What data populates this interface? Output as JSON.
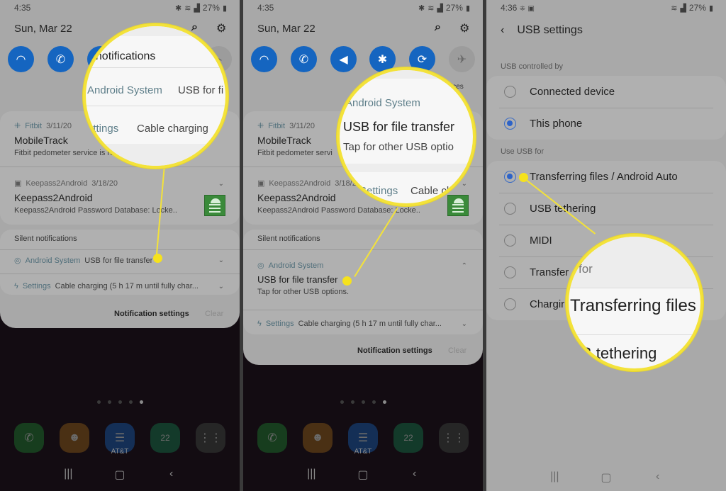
{
  "panel1": {
    "status": {
      "time": "4:35",
      "battery": "27%",
      "icons": [
        "bluetooth-icon",
        "wifi-calling-icon",
        "signal-icon",
        "battery-icon"
      ]
    },
    "date": "Sun, Mar 22",
    "quick_settings": [
      "wifi",
      "wifi-calling",
      "sound",
      "flashlight"
    ],
    "notifications": [
      {
        "app": "Fitbit",
        "time": "3/11/20",
        "title": "MobileTrack",
        "body": "Fitbit pedometer service is running"
      },
      {
        "app": "Keepass2Android",
        "time": "3/18/20",
        "title": "Keepass2Android",
        "body": "Keepass2Android Password Database: Locke.."
      }
    ],
    "silent_label": "Silent notifications",
    "silent": [
      {
        "app": "Android System",
        "text": "USB for file transfer"
      },
      {
        "app": "Settings",
        "text": "Cable charging (5 h 17 m until fully char..."
      }
    ],
    "footer": {
      "settings": "Notification settings",
      "clear": "Clear"
    },
    "carrier": "AT&T",
    "calendar_day": "22",
    "magnifier": {
      "line1": "t notifications",
      "line2_app": "Android System",
      "line2_text": "USB for fi",
      "line3_app": "ettings",
      "line3_text": "Cable charging"
    }
  },
  "panel2": {
    "status": {
      "time": "4:35",
      "battery": "27%"
    },
    "date": "Sun, Mar 22",
    "quick_settings": [
      "wifi",
      "wifi-calling",
      "sound",
      "bluetooth",
      "auto-rotate",
      "airplane-mode"
    ],
    "media_output_fragment": "ices",
    "notifications": [
      {
        "app": "Fitbit",
        "time": "3/11/20",
        "title": "MobileTrack",
        "body": "Fitbit pedometer servi"
      },
      {
        "app": "Keepass2Android",
        "time": "3/18/20",
        "title": "Keepass2Android",
        "body": "Keepass2Android Password Database: Locke.."
      }
    ],
    "silent_label": "Silent notifications",
    "expanded": {
      "app": "Android System",
      "title": "USB for file transfer",
      "body": "Tap for other USB options."
    },
    "settings_row": {
      "app": "Settings",
      "text": "Cable charging (5 h 17 m until fully char..."
    },
    "footer": {
      "settings": "Notification settings",
      "clear": "Clear"
    },
    "carrier": "AT&T",
    "calendar_day": "22",
    "magnifier": {
      "app": "Android System",
      "title": "USB for file transfer",
      "body": "Tap for other USB optio",
      "line4_app": "Settings",
      "line4_text": "Cable cl"
    }
  },
  "panel3": {
    "status": {
      "time": "4:36",
      "battery": "27%"
    },
    "title": "USB settings",
    "controlled_by_label": "USB controlled by",
    "controlled_by": [
      {
        "label": "Connected device",
        "selected": false
      },
      {
        "label": "This phone",
        "selected": true
      }
    ],
    "use_for_label": "Use USB for",
    "use_for": [
      {
        "label": "Transferring files / Android Auto",
        "selected": true
      },
      {
        "label": "USB tethering",
        "selected": false
      },
      {
        "label": "MIDI",
        "selected": false
      },
      {
        "label": "Transferring images",
        "visible": "Transfer",
        "selected": false
      },
      {
        "label": "Charging phone only",
        "visible": "Chargir",
        "selected": false
      }
    ],
    "magnifier": {
      "line1": "for",
      "line2": "Transferring files",
      "line3": "B tethering"
    }
  },
  "colors": {
    "accent_blue": "#1565c0",
    "highlight_yellow": "#f3e23a",
    "radio_blue": "#2d63c8"
  }
}
